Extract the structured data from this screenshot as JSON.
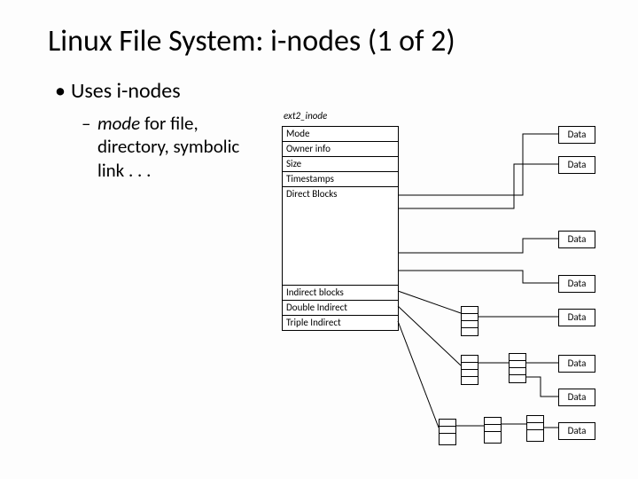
{
  "title": "Linux File System: i-nodes (1 of 2)",
  "bullets": {
    "l1": "Uses i-nodes",
    "l2_italic": "mode",
    "l2_rest": " for file, directory, symbolic link . . ."
  },
  "diagram": {
    "inode_label": "ext2_inode",
    "rows": {
      "mode": "Mode",
      "owner": "Owner info",
      "size": "Size",
      "timestamps": "Timestamps",
      "direct": "Direct Blocks",
      "indirect": "Indirect blocks",
      "double": "Double Indirect",
      "triple": "Triple Indirect"
    },
    "data_label": "Data"
  }
}
